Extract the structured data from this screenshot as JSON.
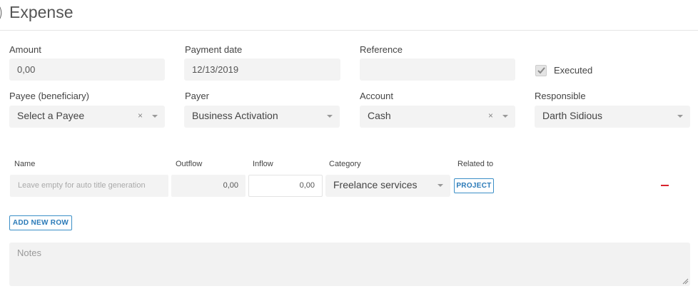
{
  "header": {
    "back_glyph": ")",
    "title": "Expense"
  },
  "form": {
    "amount_label": "Amount",
    "amount_value": "0,00",
    "payment_date_label": "Payment date",
    "payment_date_value": "12/13/2019",
    "reference_label": "Reference",
    "reference_value": "",
    "executed_label": "Executed",
    "executed_checked": true,
    "payee_label": "Payee (beneficiary)",
    "payee_value": "Select a Payee",
    "payer_label": "Payer",
    "payer_value": "Business Activation",
    "account_label": "Account",
    "account_value": "Cash",
    "responsible_label": "Responsible",
    "responsible_value": "Darth Sidious",
    "clear_glyph": "×"
  },
  "table": {
    "columns": [
      "Name",
      "Outflow",
      "Inflow",
      "Category",
      "Related to"
    ],
    "rows": [
      {
        "name_placeholder": "Leave empty for auto title generation",
        "outflow": "0,00",
        "inflow": "0,00",
        "category": "Freelance services",
        "related_button": "PROJECT"
      }
    ],
    "add_row_label": "ADD NEW ROW"
  },
  "notes": {
    "placeholder": "Notes",
    "value": ""
  },
  "colors": {
    "accent": "#2a7ab8",
    "remove": "#d9232d",
    "field_bg": "#f3f3f3"
  },
  "icons": [
    "checkmark-icon",
    "clear-icon",
    "caret-down-icon",
    "minus-icon",
    "resize-grip-icon"
  ]
}
